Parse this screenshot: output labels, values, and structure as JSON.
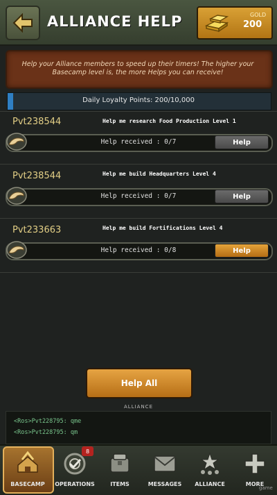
{
  "header": {
    "title": "ALLIANCE HELP",
    "gold_label": "GOLD",
    "gold_value": "200"
  },
  "info": {
    "text": "Help your Alliance members to speed up their timers! The higher your Basecamp level is, the more Helps you can receive!"
  },
  "loyalty": {
    "text": "Daily Loyalty Points: 200/10,000",
    "current": 200,
    "max": 10000
  },
  "requests": [
    {
      "name": "Pvt238544",
      "message": "Help me research Food Production Level 1",
      "progress_text": "Help received : 0/7",
      "button": "Help"
    },
    {
      "name": "Pvt238544",
      "message": "Help me build Headquarters Level 4",
      "progress_text": "Help received : 0/7",
      "button": "Help"
    },
    {
      "name": "Pvt233663",
      "message": "Help me build Fortifications Level 4",
      "progress_text": "Help received : 0/8",
      "button": "Help"
    }
  ],
  "help_all": "Help All",
  "chat": {
    "label": "ALLIANCE",
    "lines": [
      "<Ros>Pvt228795: qme",
      "<Ros>Pvt228795: qm"
    ]
  },
  "nav": {
    "items": [
      {
        "label": "BASECAMP",
        "icon": "basecamp-icon"
      },
      {
        "label": "OPERATIONS",
        "icon": "operations-icon",
        "badge": "8"
      },
      {
        "label": "ITEMS",
        "icon": "items-icon"
      },
      {
        "label": "MESSAGES",
        "icon": "messages-icon"
      },
      {
        "label": "ALLIANCE",
        "icon": "alliance-icon"
      },
      {
        "label": "MORE",
        "icon": "more-icon"
      }
    ]
  },
  "watermark": "game",
  "colors": {
    "accent_orange": "#d3912b",
    "loyalty_blue": "#2f7fc3",
    "info_bg": "#6a3218",
    "name_color": "#e3cf86"
  }
}
